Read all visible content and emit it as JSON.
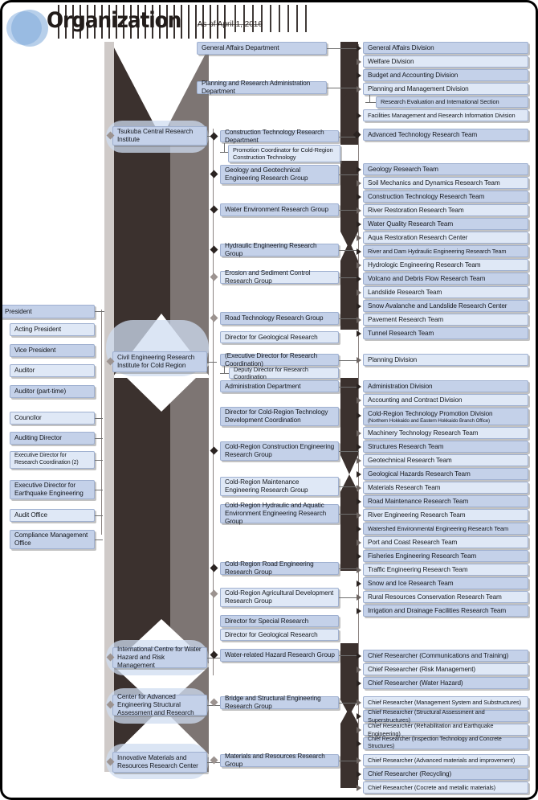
{
  "header": {
    "title": "Organization",
    "subtitle": "As of April 1, 2016",
    "logo_icon": "circle-logo-icon",
    "barcode_icon": "barcode-decoration-icon"
  },
  "sidebar": {
    "items": [
      {
        "label": "President"
      },
      {
        "label": "Acting President"
      },
      {
        "label": "Vice President"
      },
      {
        "label": "Auditor"
      },
      {
        "label": "Auditor (part-time)"
      },
      {
        "label": "Councilor"
      },
      {
        "label": "Auditing Director"
      },
      {
        "label": "Executive Director for Research Coordination (2)"
      },
      {
        "label": "Executive Director for Earthquake Engineering"
      },
      {
        "label": "Audit Office"
      },
      {
        "label": "Compliance Management Office"
      }
    ]
  },
  "institutes": [
    {
      "label": "Tsukuba Central Research Institute"
    },
    {
      "label": "Civil Engineering Research Institute for Cold Region"
    },
    {
      "label": "International Centre for Water Hazard and Risk Management"
    },
    {
      "label": "Center for Advanced Engineering Structural Assessment and Research"
    },
    {
      "label": "Innovative Materials and Resources Research Center"
    }
  ],
  "departments": [
    {
      "label": "General Affairs Department"
    },
    {
      "label": "Planning and Research Administration Department"
    },
    {
      "label": "Construction Technology Research Department"
    },
    {
      "label": "Promotion Coordinator for Cold-Region Construction Technology"
    },
    {
      "label": "Geology and Geotechnical Engineering Research Group"
    },
    {
      "label": "Water Environment Research Group"
    },
    {
      "label": "Hydraulic Engineering Research Group"
    },
    {
      "label": "Erosion and Sediment Control Research Group"
    },
    {
      "label": "Road Technology Research Group"
    },
    {
      "label": "Director for Geological Research"
    },
    {
      "label": "(Executive Director for Research Coordination)"
    },
    {
      "label": "Deputy Director for Research Coordination"
    },
    {
      "label": "Administration  Department"
    },
    {
      "label": "Director for Cold-Region Technology Development Coordination"
    },
    {
      "label": "Cold-Region Construction Engineering Research Group"
    },
    {
      "label": "Cold-Region Maintenance Engineering Research Group"
    },
    {
      "label": "Cold-Region Hydraulic and Aquatic Environment Engineering Research Group"
    },
    {
      "label": "Cold-Region Road Engineering Research Group"
    },
    {
      "label": "Cold-Region Agricultural Development Research Group"
    },
    {
      "label": "Director for Special Research"
    },
    {
      "label": "Director for Geological Research"
    },
    {
      "label": "Water-related Hazard Research Group"
    },
    {
      "label": "Bridge and Structural Engineering  Research Group"
    },
    {
      "label": "Materials and Resources Research Group"
    }
  ],
  "teams": [
    {
      "label": "General Affairs Division"
    },
    {
      "label": "Welfare Division"
    },
    {
      "label": "Budget and Accounting Division"
    },
    {
      "label": "Planning and Management Division"
    },
    {
      "label": "Research Evaluation and International Section"
    },
    {
      "label": "Facilities Management and Research Information Division"
    },
    {
      "label": "Advanced Technology Research Team"
    },
    {
      "label": "Geology Research Team"
    },
    {
      "label": "Soil Mechanics and Dynamics Research Team"
    },
    {
      "label": "Construction Technology Research Team"
    },
    {
      "label": "River Restoration Research Team"
    },
    {
      "label": "Water Quality Research Team"
    },
    {
      "label": "Aqua Restoration Research Center"
    },
    {
      "label": "River and Dam Hydraulic Engineering Research Team"
    },
    {
      "label": "Hydrologic Engineering Research Team"
    },
    {
      "label": "Volcano and Debris Flow Research Team"
    },
    {
      "label": "Landslide Research Team"
    },
    {
      "label": "Snow Avalanche and Landslide Research Center"
    },
    {
      "label": "Pavement Research Team"
    },
    {
      "label": "Tunnel Research Team"
    },
    {
      "label": "Planning Division"
    },
    {
      "label": "Administration Division"
    },
    {
      "label": "Accounting and Contract Division"
    },
    {
      "label": "Cold-Region Technology Promotion Division",
      "sub": "(Northern Hokkaido and Eastern Hokkaido Branch Office)"
    },
    {
      "label": "Machinery Technology Research Team"
    },
    {
      "label": "Structures Research Team"
    },
    {
      "label": "Geotechnical Research Team"
    },
    {
      "label": "Geological Hazards Research Team"
    },
    {
      "label": "Materials Research Team"
    },
    {
      "label": "Road Maintenance Research Team"
    },
    {
      "label": "River Engineering Research Team"
    },
    {
      "label": "Watershed Environmental Engineering Research Team"
    },
    {
      "label": "Port and Coast Research Team"
    },
    {
      "label": "Fisheries Engineering Research Team"
    },
    {
      "label": "Traffic Engineering Research Team"
    },
    {
      "label": "Snow and Ice Research Team"
    },
    {
      "label": "Rural Resources Conservation Research Team"
    },
    {
      "label": "Irrigation and Drainage Facilities Research Team"
    },
    {
      "label": "Chief Researcher (Communications and Training)"
    },
    {
      "label": "Chief Researcher (Risk Management)"
    },
    {
      "label": "Chief Researcher (Water Hazard)"
    },
    {
      "label": "Chief Researcher (Management System and Substructures)"
    },
    {
      "label": "Chief Researcher (Structural Assessment and Superstructures)"
    },
    {
      "label": "Chief Researcher (Rehabilitation and Earthquake Engineering)"
    },
    {
      "label": "Chief Researcher (Inspection Technology and Concrete Structures)"
    },
    {
      "label": "Chief Researcher (Advanced materials and improvement)"
    },
    {
      "label": "Chief Researcher (Recycling)"
    },
    {
      "label": "Chief Researcher (Cocrete and metallic materials)"
    }
  ],
  "colors": {
    "box_fill": "#c4d1e9",
    "box_fill_pale": "#dfe8f6",
    "spine_dark": "#3b312e",
    "spine_gray": "#7d7573",
    "logo_blue": "#7ba7d9",
    "text": "#15181d"
  }
}
